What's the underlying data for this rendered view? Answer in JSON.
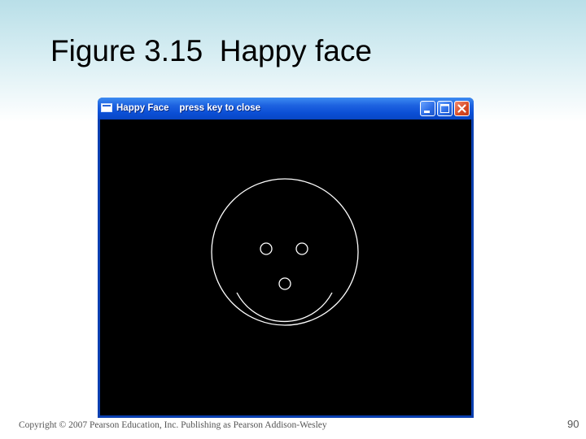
{
  "slide": {
    "title": "Figure 3.15  Happy face",
    "footer": "Copyright © 2007 Pearson Education, Inc. Publishing as Pearson Addison-Wesley",
    "page_number": "90"
  },
  "window": {
    "title": "Happy Face    press key to close",
    "controls": {
      "minimize_icon": "minimize-icon",
      "maximize_icon": "maximize-icon",
      "close_icon": "close-icon"
    },
    "canvas": {
      "background": "#000000",
      "stroke": "#ffffff",
      "drawing": "happy-face"
    }
  }
}
